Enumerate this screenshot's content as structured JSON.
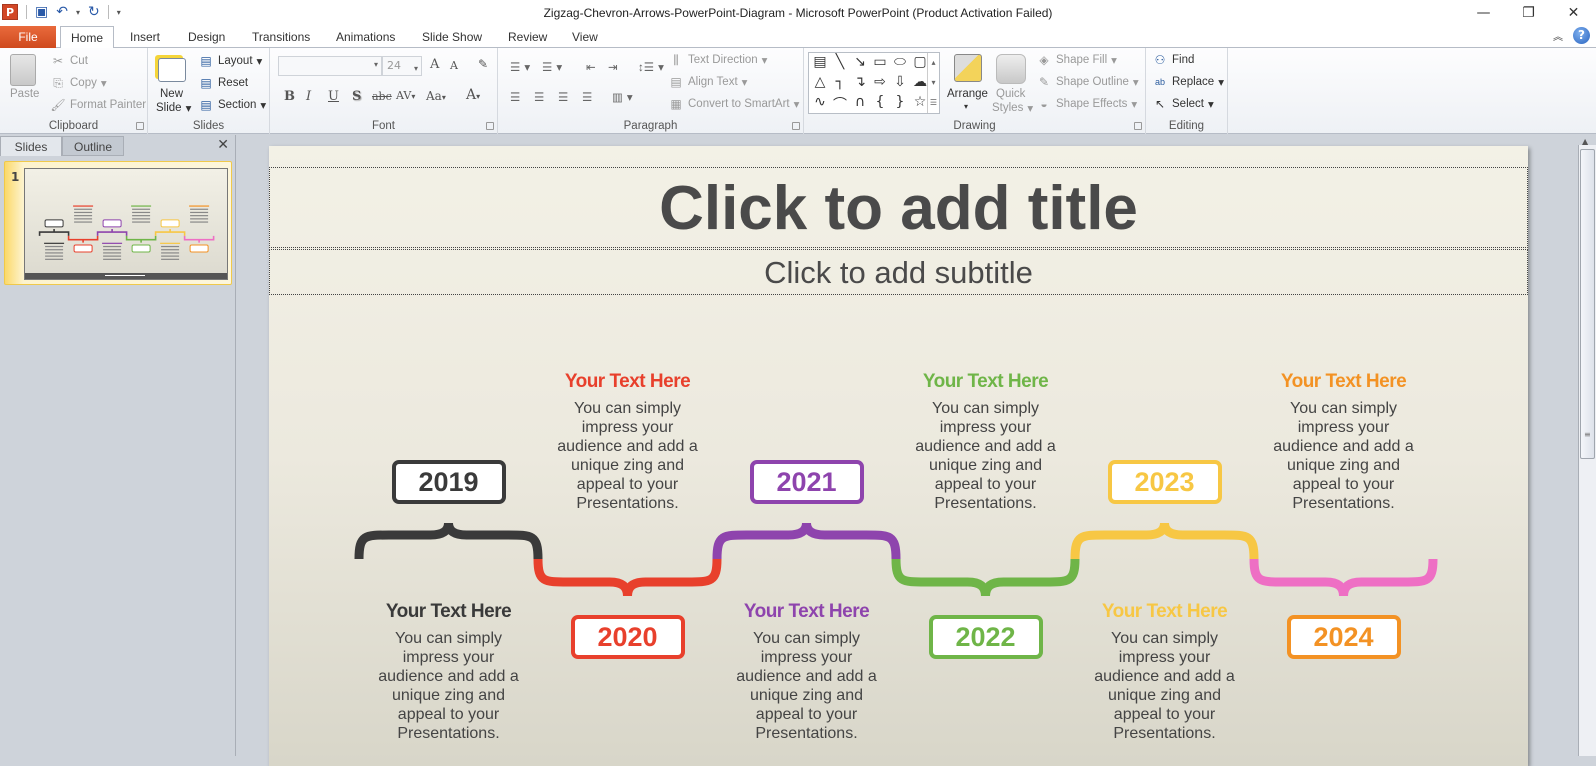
{
  "window": {
    "title": "Zigzag-Chevron-Arrows-PowerPoint-Diagram  -  Microsoft PowerPoint (Product Activation Failed)",
    "app_icon": "P",
    "minimize": "—",
    "restore": "❐",
    "close": "✕"
  },
  "quick_access": [
    "save-icon",
    "undo-icon",
    "redo-icon",
    "customize-icon"
  ],
  "tabs": [
    {
      "label": "File"
    },
    {
      "label": "Home"
    },
    {
      "label": "Insert"
    },
    {
      "label": "Design"
    },
    {
      "label": "Transitions"
    },
    {
      "label": "Animations"
    },
    {
      "label": "Slide Show"
    },
    {
      "label": "Review"
    },
    {
      "label": "View"
    }
  ],
  "ribbon": {
    "clipboard": {
      "label": "Clipboard",
      "paste": "Paste",
      "cut": "Cut",
      "copy": "Copy",
      "format_painter": "Format Painter"
    },
    "slides": {
      "label": "Slides",
      "new_slide_1": "New",
      "new_slide_2": "Slide",
      "layout": "Layout",
      "reset": "Reset",
      "section": "Section"
    },
    "font": {
      "label": "Font",
      "font_name": "",
      "font_size": "24",
      "bold": "B",
      "italic": "I",
      "underline": "U",
      "shadow": "S",
      "strike": "abc",
      "spacing": "AV",
      "case": "Aa",
      "color": "A",
      "grow": "A",
      "shrink": "A"
    },
    "paragraph": {
      "label": "Paragraph",
      "text_direction": "Text Direction",
      "align_text": "Align Text",
      "convert_smartart": "Convert to SmartArt"
    },
    "drawing": {
      "label": "Drawing",
      "arrange": "Arrange",
      "quick_styles_1": "Quick",
      "quick_styles_2": "Styles",
      "shape_fill": "Shape Fill",
      "shape_outline": "Shape Outline",
      "shape_effects": "Shape Effects"
    },
    "editing": {
      "label": "Editing",
      "find": "Find",
      "replace": "Replace",
      "select": "Select"
    }
  },
  "panel": {
    "tab_slides": "Slides",
    "tab_outline": "Outline",
    "close": "✕",
    "slide_number": "1"
  },
  "slide": {
    "title_placeholder": "Click to add title",
    "subtitle_placeholder": "Click to add subtitle",
    "milestones": [
      {
        "year": "2019",
        "color": "#3a3a3a",
        "heading": "Your Text Here",
        "body": "You can simply impress your audience and add a unique zing and appeal to your Presentations.",
        "box": "top",
        "text": "bottom"
      },
      {
        "year": "2020",
        "color": "#e8402c",
        "heading": "Your Text Here",
        "body": "You can simply impress your audience and add a unique zing and appeal to your Presentations.",
        "box": "bottom",
        "text": "top"
      },
      {
        "year": "2021",
        "color": "#8e44ad",
        "heading": "Your Text Here",
        "body": "You can simply impress your audience and add a unique zing and appeal to your Presentations.",
        "box": "top",
        "text": "bottom"
      },
      {
        "year": "2022",
        "color": "#6fb548",
        "heading": "Your Text Here",
        "body": "You can simply impress your audience and add a unique zing and appeal to your Presentations.",
        "box": "bottom",
        "text": "top"
      },
      {
        "year": "2023",
        "color": "#f7c744",
        "heading": "Your Text Here",
        "body": "You can simply impress your audience and add a unique zing and appeal to your Presentations.",
        "box": "top",
        "text": "bottom"
      },
      {
        "year": "2024",
        "color": "#f39224",
        "heading": "Your Text Here",
        "body": "You can simply impress your audience and add a unique zing and appeal to your Presentations.",
        "box": "bottom",
        "text": "top",
        "brace_color": "#ee6fc4",
        "heading_color": "#f39224"
      }
    ]
  }
}
